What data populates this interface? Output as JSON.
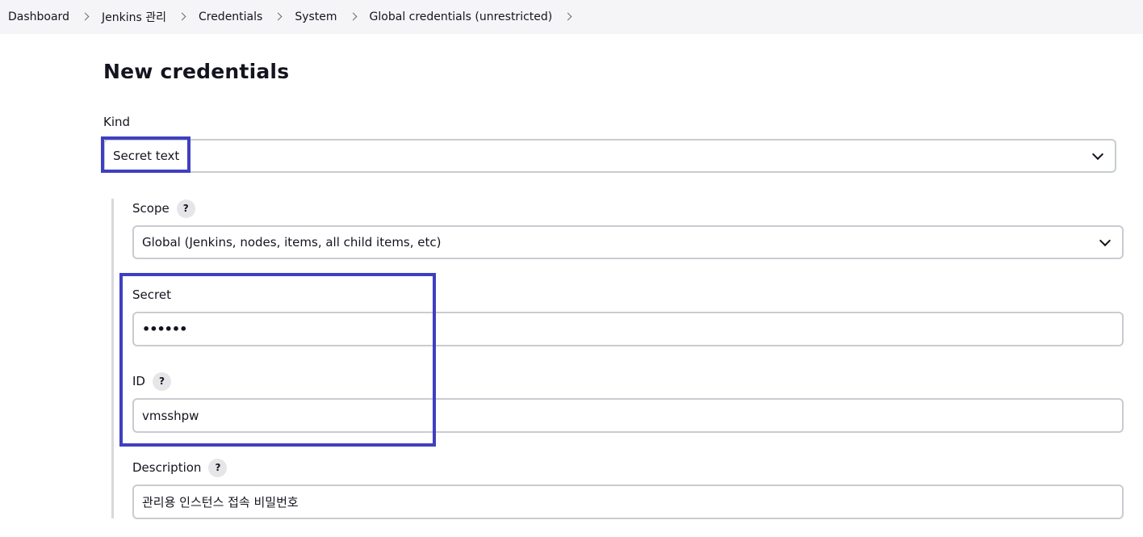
{
  "breadcrumb": {
    "items": [
      {
        "label": "Dashboard"
      },
      {
        "label": "Jenkins 관리"
      },
      {
        "label": "Credentials"
      },
      {
        "label": "System"
      },
      {
        "label": "Global credentials (unrestricted)"
      }
    ]
  },
  "page": {
    "title": "New credentials"
  },
  "form": {
    "kind": {
      "label": "Kind",
      "value": "Secret text"
    },
    "scope": {
      "label": "Scope",
      "help": "?",
      "value": "Global (Jenkins, nodes, items, all child items, etc)"
    },
    "secret": {
      "label": "Secret",
      "value": "••••••"
    },
    "id": {
      "label": "ID",
      "help": "?",
      "value": "vmsshpw"
    },
    "description": {
      "label": "Description",
      "help": "?",
      "value": "관리용 인스턴스 접속 비밀번호"
    }
  },
  "annotation_color": "#3f3fc2"
}
